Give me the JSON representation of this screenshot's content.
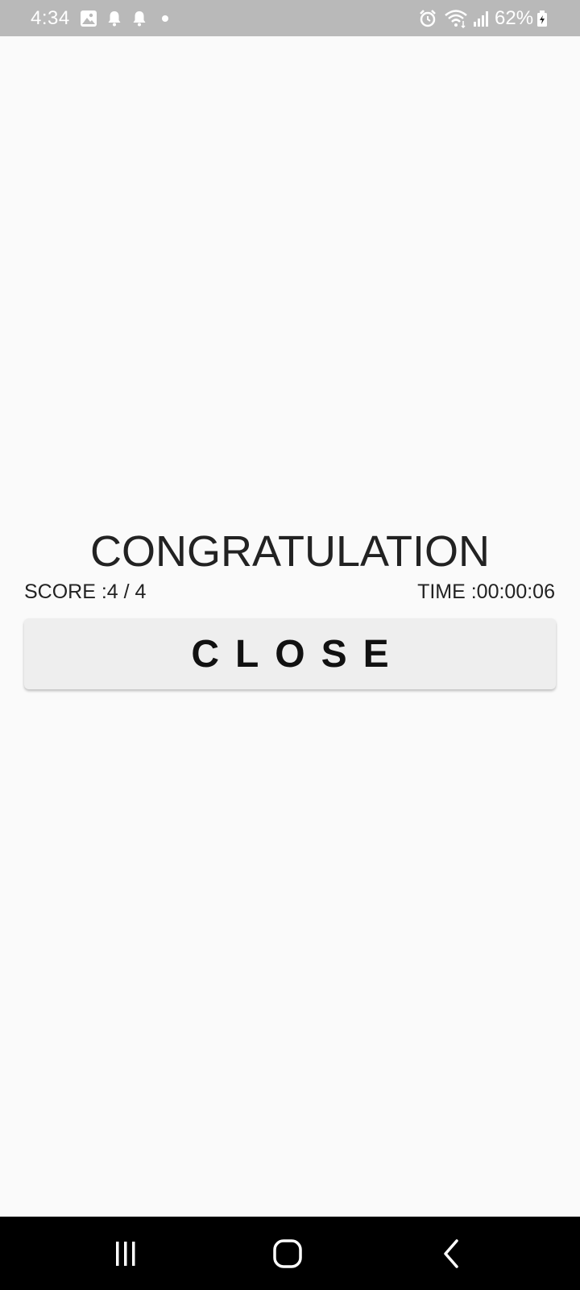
{
  "status_bar": {
    "time": "4:34",
    "battery": "62%",
    "icons": [
      "gallery-icon",
      "notification-bell-icon",
      "notification-bell-icon",
      "dot-icon",
      "alarm-icon",
      "wifi-icon",
      "signal-icon",
      "battery-icon"
    ]
  },
  "result": {
    "title": "CONGRATULATION",
    "score": "SCORE :4 / 4",
    "time": "TIME :00:00:06",
    "close_label": "CLOSE"
  },
  "nav_bar": {
    "buttons": [
      "recent-apps-icon",
      "home-icon",
      "back-icon"
    ]
  },
  "colors": {
    "background": "#fafafa",
    "status_bar": "#b9b9b9",
    "button": "#eeeeee",
    "nav_bar": "#000000"
  }
}
